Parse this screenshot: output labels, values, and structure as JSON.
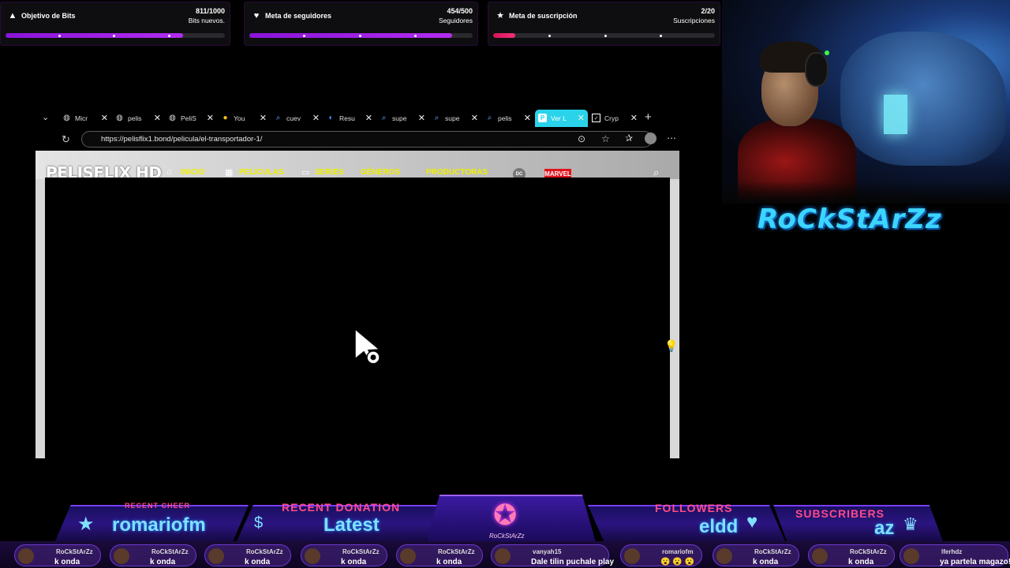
{
  "goals": [
    {
      "title": "Objetivo de Bits",
      "count": "811/1000",
      "subtitle": "Bits nuevos.",
      "progress": 0.811,
      "icon": "bits-icon"
    },
    {
      "title": "Meta de seguidores",
      "count": "454/500",
      "subtitle": "Seguidores",
      "progress": 0.908,
      "icon": "heart-hand-icon"
    },
    {
      "title": "Meta de suscripción",
      "count": "2/20",
      "subtitle": "Suscripciones",
      "progress": 0.1,
      "icon": "star-icon"
    }
  ],
  "browser": {
    "tabs": [
      {
        "label": "Micr",
        "icon": "globe-icon",
        "active": false
      },
      {
        "label": "pelis",
        "icon": "globe-icon",
        "active": false
      },
      {
        "label": "PeliS",
        "icon": "globe-icon",
        "active": false
      },
      {
        "label": "You",
        "icon": "emoji-icon",
        "active": false
      },
      {
        "label": "cuev",
        "icon": "search-icon",
        "active": false
      },
      {
        "label": "Resu",
        "icon": "copilot-icon",
        "active": false
      },
      {
        "label": "supe",
        "icon": "search-icon",
        "active": false
      },
      {
        "label": "supe",
        "icon": "search-icon",
        "active": false
      },
      {
        "label": "pelis",
        "icon": "search-icon",
        "active": false
      },
      {
        "label": "Ver L",
        "icon": "p-icon",
        "active": true
      },
      {
        "label": "Cryp",
        "icon": "crypto-icon",
        "active": false
      }
    ],
    "url": "https://pelisflix1.bond/pelicula/el-transportador-1/"
  },
  "site": {
    "logo": "PELISFLIX HD",
    "nav": [
      "INICIO",
      "PELÍCULAS",
      "SERIES",
      "GÉNEROS",
      "PRODUCTORAS"
    ],
    "dc": "DC",
    "marvel": "MARVEL"
  },
  "brand": "RoCkStArZz",
  "overlay": {
    "cheer_label": "RECENT CHEER",
    "cheer_value": "romariofm",
    "donation_label": "RECENT DONATION",
    "donation_value": "Latest",
    "emblem_text": "RoCkStArZz",
    "followers_label": "FOLLOWERS",
    "followers_value": "eldd",
    "subscribers_label": "SUBSCRIBERS",
    "subscribers_value": "az"
  },
  "chat": [
    {
      "user": "RoCkStArZz",
      "msg": "k onda"
    },
    {
      "user": "RoCkStArZz",
      "msg": "k onda"
    },
    {
      "user": "RoCkStArZz",
      "msg": "k onda"
    },
    {
      "user": "RoCkStArZz",
      "msg": "k onda"
    },
    {
      "user": "RoCkStArZz",
      "msg": "k onda"
    },
    {
      "user": "vanyah15",
      "msg": "Dale tilin puchale play"
    },
    {
      "user": "romariofm",
      "msg": "😮 😮 😮"
    },
    {
      "user": "RoCkStArZz",
      "msg": "k onda"
    },
    {
      "user": "RoCkStArZz",
      "msg": "k onda"
    },
    {
      "user": "lferhdz",
      "msg": "ya partela magazo!"
    }
  ]
}
